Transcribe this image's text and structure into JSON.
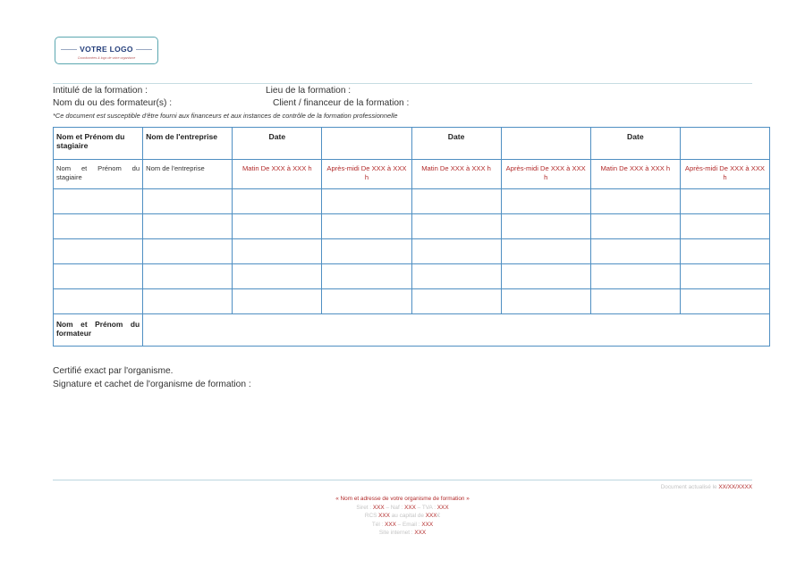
{
  "logo": {
    "text": "VOTRE LOGO",
    "tagline": "Coordonnées & logo de votre organisme"
  },
  "header": {
    "intitule": "Intitulé de la formation :",
    "lieu": "Lieu de la formation :",
    "formateurs": "Nom du ou des formateur(s) :",
    "client": "Client / financeur de la formation :",
    "note": "*Ce document est susceptible d'être fourni aux financeurs et aux instances de contrôle de la formation professionnelle"
  },
  "table": {
    "headers": [
      "Nom et Prénom du stagiaire",
      "Nom de l'entreprise",
      "Date",
      "",
      "Date",
      "",
      "Date",
      ""
    ],
    "subrow": {
      "name": "Nom et Prénom du stagiaire",
      "company": "Nom de l'entreprise",
      "slots": [
        "Matin De XXX à XXX h",
        "Après-midi De XXX à XXX h",
        "Matin De XXX à XXX h",
        "Après-midi De XXX à XXX h",
        "Matin De XXX à XXX h",
        "Après-midi De XXX à XXX h"
      ]
    },
    "trainer_label": "Nom et Prénom du formateur"
  },
  "certification": {
    "line1": "Certifié exact par l'organisme.",
    "line2": "Signature et cachet de l'organisme de formation :"
  },
  "footer": {
    "updated_label": "Document actualisé le",
    "updated_value": "XX/XX/XXXX",
    "org_line": "« Nom et adresse de votre organisme de formation »",
    "siret_label": "Siret :",
    "siret_value": "XXX",
    "naf_label": "– Naf :",
    "naf_value": "XXX",
    "tva_label": "– TVA :",
    "tva_value": "XXX",
    "rcs_label": "RCS",
    "rcs_value": "XXX",
    "capital_label": "au capital de",
    "capital_value": "XXX",
    "capital_suffix": "€",
    "tel_label": "Tél :",
    "tel_value": "XXX",
    "email_label": "– Email :",
    "email_value": "XXX",
    "site_label": "Site internet :",
    "site_value": "XXX"
  }
}
